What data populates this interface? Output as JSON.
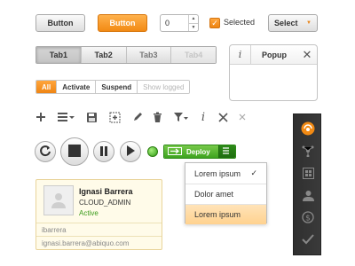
{
  "row1": {
    "button_label": "Button",
    "button_primary_label": "Button",
    "stepper_value": "0",
    "checkbox_label": "Selected",
    "checkbox_checked": true,
    "select_label": "Select"
  },
  "tabs": [
    {
      "label": "Tab1",
      "state": "active"
    },
    {
      "label": "Tab2",
      "state": "normal"
    },
    {
      "label": "Tab3",
      "state": "normal"
    },
    {
      "label": "Tab4",
      "state": "disabled"
    }
  ],
  "popup": {
    "title": "Popup",
    "info_glyph": "i",
    "close_glyph": "✕"
  },
  "filters": [
    "All",
    "Activate",
    "Suspend",
    "Show logged"
  ],
  "toolbar_icons": [
    "plus-icon",
    "list-icon",
    "save-icon",
    "add-box-icon",
    "pencil-icon",
    "trash-icon",
    "filter-icon",
    "info-icon",
    "close-icon",
    "close-small-icon"
  ],
  "deploy": {
    "label": "Deploy"
  },
  "menu": {
    "items": [
      {
        "label": "Lorem ipsum",
        "checked": true
      },
      {
        "label": "Dolor amet",
        "checked": false
      },
      {
        "label": "Lorem ipsum",
        "checked": false
      }
    ],
    "check_glyph": "✓"
  },
  "user_card": {
    "name": "Ignasi Barrera",
    "role": "CLOUD_ADMIN",
    "status": "Active",
    "username": "ibarrera",
    "email": "ignasi.barrera@abiquo.com"
  },
  "sidebar_icons": [
    "logo-icon",
    "network-icon",
    "grid-icon",
    "users-icon",
    "dollar-icon",
    "check-icon"
  ],
  "colors": {
    "accent": "#F28A14",
    "success": "#3EA31F",
    "sidebar": "#333333"
  }
}
